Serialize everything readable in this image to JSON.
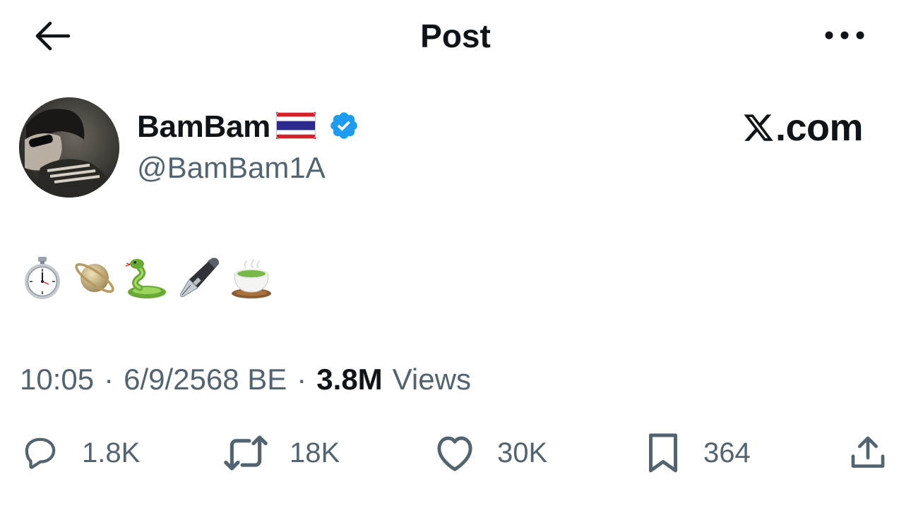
{
  "header": {
    "title": "Post",
    "back_icon": "arrow-left-icon",
    "more_icon": "more-horizontal-icon"
  },
  "author": {
    "display_name": "BamBam",
    "flag": "thailand-flag",
    "verified_icon": "verified-badge-icon",
    "handle": "@BamBam1A"
  },
  "watermark": {
    "text": ".com",
    "logo": "x-logo-icon"
  },
  "post": {
    "emojis": [
      "stopwatch-icon",
      "ringed-planet-icon",
      "snake-icon",
      "fountain-pen-icon",
      "green-tea-icon"
    ]
  },
  "meta": {
    "time": "10:05",
    "separator": "·",
    "date": "6/9/2568 BE",
    "views_count": "3.8M",
    "views_label": "Views"
  },
  "actions": {
    "reply_count": "1.8K",
    "repost_count": "18K",
    "like_count": "30K",
    "bookmark_count": "364"
  },
  "colors": {
    "text_primary": "#0f1419",
    "text_secondary": "#536471",
    "verified_blue": "#1d9bf0"
  }
}
